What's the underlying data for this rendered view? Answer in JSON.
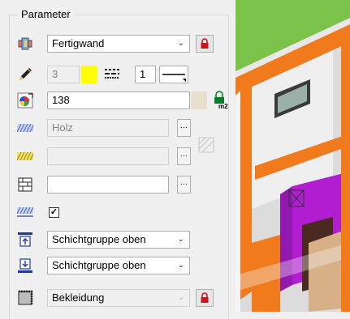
{
  "panel": {
    "title": "Parameter",
    "rows": {
      "layer": {
        "select_value": "Fertigwand",
        "icon": "layer-stack-icon"
      },
      "pen": {
        "pen_value": "3",
        "line_value": "1",
        "color": "#ffff00",
        "icon": "pencil-icon"
      },
      "area": {
        "value": "138",
        "unit_icon": "lock-m2-icon",
        "swatch_color": "#e8e0cc",
        "icon": "color-wheel-icon"
      },
      "material": {
        "value": "Holz",
        "icon": "hatch-blue-icon"
      },
      "pattern": {
        "value": "",
        "icon": "hatch-yellow-icon"
      },
      "brick": {
        "value": "",
        "icon": "brick-icon"
      },
      "flag": {
        "checked": "✓",
        "icon": "hatch-check-icon"
      },
      "top_group": {
        "value": "Schichtgruppe oben",
        "icon": "layer-top-icon"
      },
      "bottom_group": {
        "value": "Schichtgruppe oben",
        "icon": "layer-bottom-icon"
      },
      "cladding": {
        "value": "Bekleidung",
        "icon": "cladding-icon"
      }
    }
  },
  "colors": {
    "accent_lock": "#cc1122",
    "viewport_green": "#7bc24a",
    "wall_orange": "#f07a1c",
    "wall_purple": "#b01ed0"
  }
}
